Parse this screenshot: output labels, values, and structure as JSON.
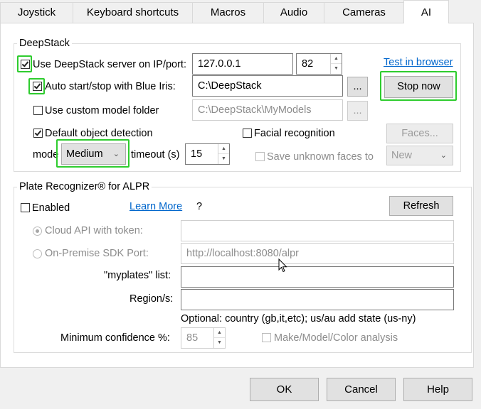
{
  "tabs": [
    {
      "label": "Joystick"
    },
    {
      "label": "Keyboard shortcuts"
    },
    {
      "label": "Macros"
    },
    {
      "label": "Audio"
    },
    {
      "label": "Cameras"
    },
    {
      "label": "AI"
    }
  ],
  "deepstack": {
    "group_title": "DeepStack",
    "use_server": {
      "label": "Use DeepStack server on IP/port:",
      "checked": true
    },
    "ip": "127.0.0.1",
    "port": "82",
    "test_link": "Test in browser",
    "auto_start": {
      "label": "Auto start/stop with Blue Iris:",
      "checked": true
    },
    "path": "C:\\DeepStack",
    "browse1": "...",
    "stop_button": "Stop now",
    "custom_model": {
      "label": "Use custom model folder",
      "checked": false
    },
    "custom_path": "C:\\DeepStack\\MyModels",
    "browse2": "...",
    "default_detection": {
      "label": "Default object detection",
      "checked": true
    },
    "facial": {
      "label": "Facial recognition",
      "checked": false
    },
    "faces_button": "Faces...",
    "mode_label": "mode",
    "mode_value": "Medium",
    "timeout_label": "timeout (s)",
    "timeout_value": "15",
    "save_unknown": {
      "label": "Save unknown faces to",
      "checked": false
    },
    "save_select": "New"
  },
  "plate": {
    "group_title": "Plate Recognizer® for ALPR",
    "enabled": {
      "label": "Enabled",
      "checked": false
    },
    "learn_more": "Learn More",
    "question": "?",
    "refresh_button": "Refresh",
    "cloud_label": "Cloud API with token:",
    "onprem_label": "On-Premise SDK Port:",
    "onprem_value": "http://localhost:8080/alpr",
    "myplates_label": "\"myplates\" list:",
    "region_label": "Region/s:",
    "optional_note": "Optional: country (gb,it,etc); us/au add state (us-ny)",
    "min_conf_label": "Minimum confidence %:",
    "min_conf_value": "85",
    "mmc": {
      "label": "Make/Model/Color analysis",
      "checked": false
    }
  },
  "footer": {
    "ok": "OK",
    "cancel": "Cancel",
    "help": "Help"
  },
  "colors": {
    "highlight": "#2ecc2e",
    "link": "#0066cc"
  }
}
